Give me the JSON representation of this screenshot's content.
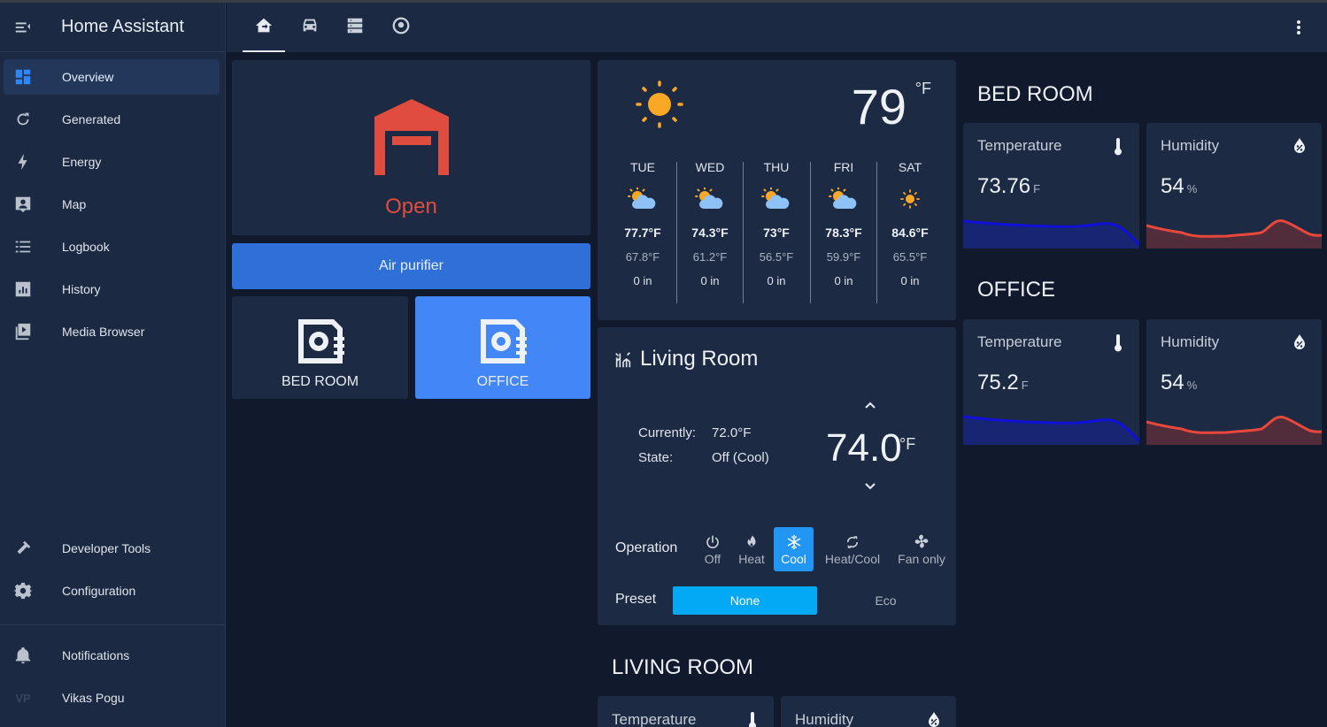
{
  "app": {
    "title": "Home Assistant"
  },
  "sidebar": {
    "items": [
      {
        "label": "Overview",
        "icon": "dashboard-icon",
        "active": true
      },
      {
        "label": "Generated",
        "icon": "refresh-icon"
      },
      {
        "label": "Energy",
        "icon": "lightning-icon"
      },
      {
        "label": "Map",
        "icon": "map-account-icon"
      },
      {
        "label": "Logbook",
        "icon": "list-icon"
      },
      {
        "label": "History",
        "icon": "chart-box-icon"
      },
      {
        "label": "Media Browser",
        "icon": "media-play-icon"
      }
    ],
    "bottom_items": [
      {
        "label": "Developer Tools",
        "icon": "hammer-icon"
      },
      {
        "label": "Configuration",
        "icon": "gear-icon"
      }
    ],
    "notifications_label": "Notifications",
    "user": {
      "initials": "VP",
      "name": "Vikas Pogu"
    }
  },
  "toolbar": {
    "tabs": [
      {
        "icon": "home-floor-icon",
        "active": true
      },
      {
        "icon": "car-icon"
      },
      {
        "icon": "server-icon"
      },
      {
        "icon": "robot-vacuum-icon"
      }
    ],
    "menu_icon": "dots-vertical-icon"
  },
  "garage": {
    "state": "Open",
    "color": "#e04d3e"
  },
  "air_purifier": {
    "label": "Air purifier"
  },
  "purifiers": [
    {
      "name": "BED ROOM",
      "active": false
    },
    {
      "name": "OFFICE",
      "active": true
    }
  ],
  "weather": {
    "temperature": "79",
    "unit": "°F",
    "condition": "sunny",
    "forecast": [
      {
        "day": "TUE",
        "high": "77.7°F",
        "low": "67.8°F",
        "precip": "0 in",
        "condition": "partly-cloudy"
      },
      {
        "day": "WED",
        "high": "74.3°F",
        "low": "61.2°F",
        "precip": "0 in",
        "condition": "partly-cloudy"
      },
      {
        "day": "THU",
        "high": "73°F",
        "low": "56.5°F",
        "precip": "0 in",
        "condition": "partly-cloudy"
      },
      {
        "day": "FRI",
        "high": "78.3°F",
        "low": "59.9°F",
        "precip": "0 in",
        "condition": "partly-cloudy"
      },
      {
        "day": "SAT",
        "high": "84.6°F",
        "low": "65.5°F",
        "precip": "0 in",
        "condition": "sunny"
      }
    ]
  },
  "thermostat": {
    "title": "Living Room",
    "currently_label": "Currently:",
    "currently_value": "72.0°F",
    "state_label": "State:",
    "state_value": "Off (Cool)",
    "target": "74.0",
    "target_unit": "°F",
    "operation_label": "Operation",
    "operations": [
      {
        "label": "Off",
        "icon": "power-icon"
      },
      {
        "label": "Heat",
        "icon": "fire-icon"
      },
      {
        "label": "Cool",
        "icon": "snowflake-icon",
        "active": true
      },
      {
        "label": "Heat/Cool",
        "icon": "autorenew-icon"
      },
      {
        "label": "Fan only",
        "icon": "fan-icon"
      }
    ],
    "preset_label": "Preset",
    "presets": [
      {
        "label": "None",
        "active": true
      },
      {
        "label": "Eco"
      }
    ]
  },
  "rooms": {
    "bed_room": {
      "title": "BED ROOM",
      "temperature": {
        "label": "Temperature",
        "value": "73.76",
        "unit": "F"
      },
      "humidity": {
        "label": "Humidity",
        "value": "54",
        "unit": "%"
      }
    },
    "office": {
      "title": "OFFICE",
      "temperature": {
        "label": "Temperature",
        "value": "75.2",
        "unit": "F"
      },
      "humidity": {
        "label": "Humidity",
        "value": "54",
        "unit": "%"
      }
    },
    "living_room": {
      "title": "LIVING ROOM",
      "temperature": {
        "label": "Temperature"
      },
      "humidity": {
        "label": "Humidity"
      }
    }
  },
  "colors": {
    "accent": "#2196f3",
    "garage_open": "#e04d3e",
    "temp_graph": "#1010d8",
    "humidity_graph": "#e8473c",
    "sun": "#f9a825"
  }
}
